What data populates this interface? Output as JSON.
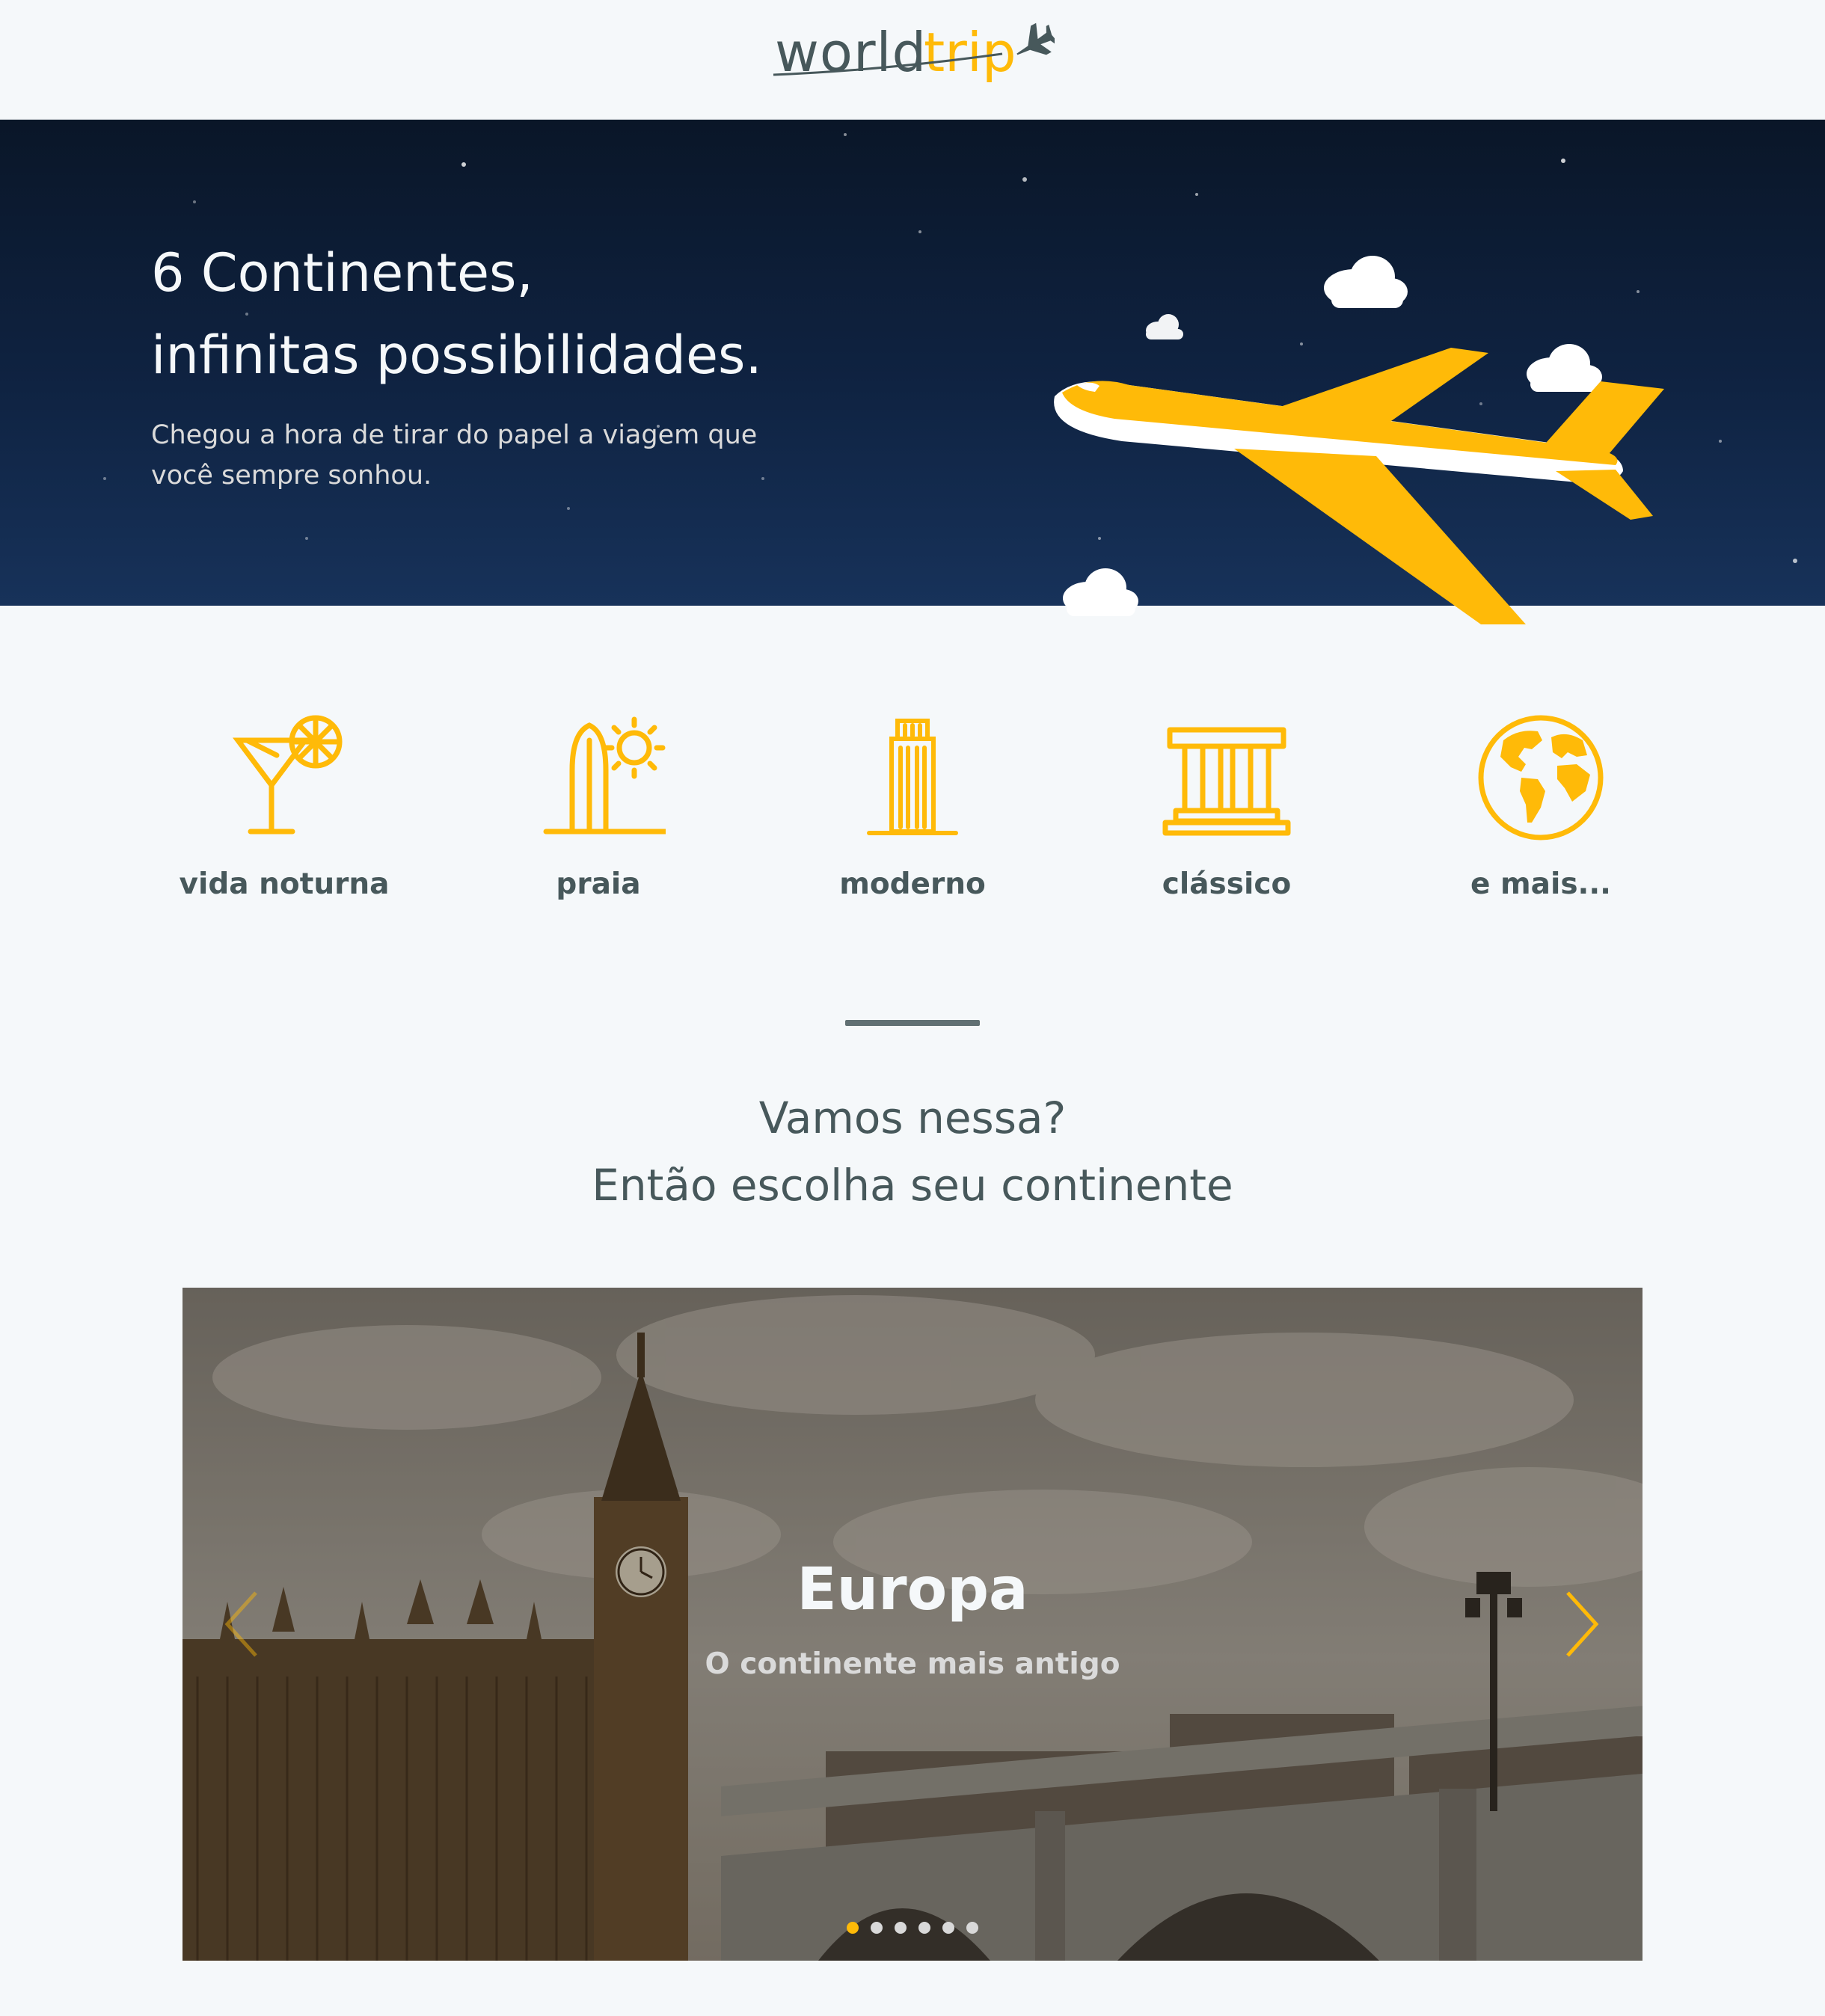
{
  "header": {
    "logo": {
      "part1": "world",
      "part2": "trip"
    }
  },
  "banner": {
    "title_line1": "6 Continentes,",
    "title_line2": "infinitas possibilidades.",
    "subtitle_line1": "Chegou a hora de tirar do papel a viagem que",
    "subtitle_line2": "você sempre sonhou."
  },
  "categories": [
    {
      "label": "vida noturna",
      "icon": "cocktail-icon"
    },
    {
      "label": "praia",
      "icon": "surfboard-icon"
    },
    {
      "label": "moderno",
      "icon": "building-icon"
    },
    {
      "label": "clássico",
      "icon": "museum-icon"
    },
    {
      "label": "e mais...",
      "icon": "earth-icon"
    }
  ],
  "cta": {
    "line1": "Vamos nessa?",
    "line2": "Então escolha seu continente"
  },
  "slider": {
    "title": "Europa",
    "subtitle": "O continente mais antigo",
    "slide_count": 6,
    "active_index": 0
  },
  "colors": {
    "accent": "#ffba08",
    "text_dark": "#47585b",
    "background": "#f5f8fa",
    "banner_bg": "#0f2342"
  }
}
